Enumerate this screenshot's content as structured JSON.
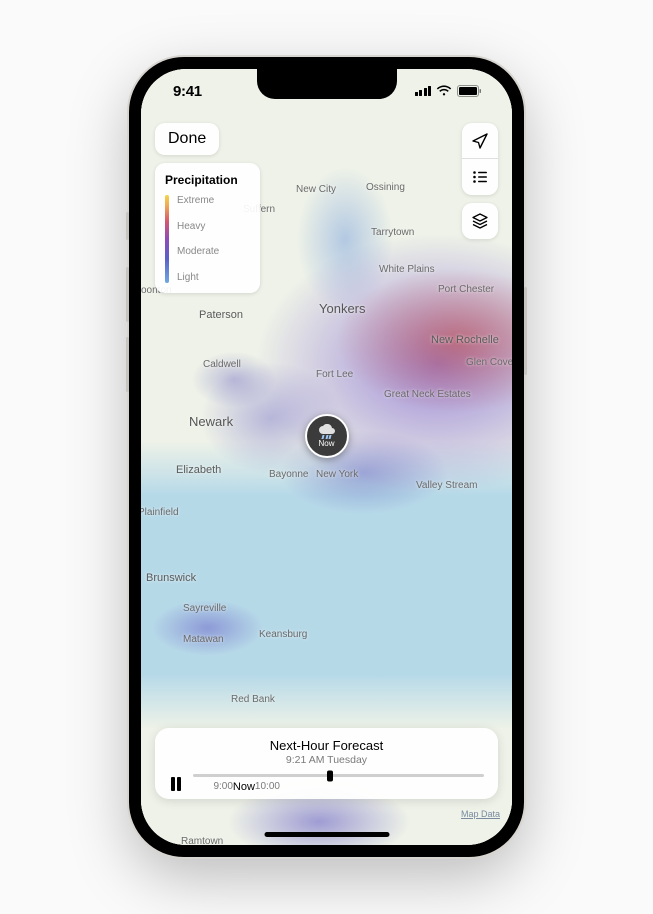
{
  "status": {
    "time": "9:41"
  },
  "done_label": "Done",
  "legend": {
    "title": "Precipitation",
    "levels": [
      "Extreme",
      "Heavy",
      "Moderate",
      "Light"
    ]
  },
  "marker": {
    "label": "Now"
  },
  "timeline": {
    "title": "Next-Hour Forecast",
    "subtitle": "9:21 AM Tuesday",
    "labels": {
      "start": "9:00",
      "now": "Now",
      "end": "10:00"
    }
  },
  "map_data_label": "Map Data",
  "cities": {
    "new_city": "New City",
    "ossining": "Ossining",
    "suffern": "Suffern",
    "tarrytown": "Tarrytown",
    "white_plains": "White Plains",
    "port_chester": "Port Chester",
    "paterson": "Paterson",
    "yonkers": "Yonkers",
    "new_rochelle": "New Rochelle",
    "glen_cove": "Glen Cove",
    "caldwell": "Caldwell",
    "fort_lee": "Fort Lee",
    "great_neck": "Great Neck Estates",
    "newark": "Newark",
    "elizabeth": "Elizabeth",
    "bayonne": "Bayonne",
    "new_york": "New York",
    "valley_stream": "Valley Stream",
    "plainfield": "Plainfield",
    "brunswick": "Brunswick",
    "sayreville": "Sayreville",
    "matawan": "Matawan",
    "keansburg": "Keansburg",
    "red_bank": "Red Bank",
    "oonton": "oonton",
    "ramtown": "Ramtown"
  }
}
